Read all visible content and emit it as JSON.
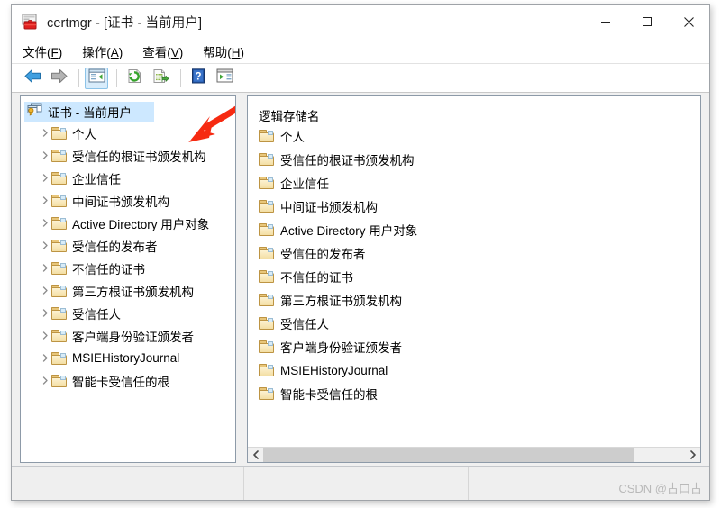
{
  "window": {
    "title": "certmgr - [证书 - 当前用户]",
    "app_icon": "certificate-icon",
    "controls": {
      "minimize": "minimize-icon",
      "maximize": "maximize-icon",
      "close": "close-icon"
    }
  },
  "menubar": {
    "items": [
      {
        "text": "文件(F)",
        "label": "文件",
        "accel": "F"
      },
      {
        "text": "操作(A)",
        "label": "操作",
        "accel": "A"
      },
      {
        "text": "查看(V)",
        "label": "查看",
        "accel": "V"
      },
      {
        "text": "帮助(H)",
        "label": "帮助",
        "accel": "H"
      }
    ]
  },
  "toolbar": {
    "buttons": [
      {
        "name": "back-button",
        "icon": "back-arrow-icon"
      },
      {
        "name": "forward-button",
        "icon": "forward-arrow-icon"
      },
      {
        "name": "show-hide-console-tree-button",
        "icon": "console-tree-icon",
        "active": true
      },
      {
        "name": "refresh-button",
        "icon": "refresh-icon"
      },
      {
        "name": "export-list-button",
        "icon": "export-list-icon"
      },
      {
        "name": "help-button",
        "icon": "help-icon"
      },
      {
        "name": "properties-button",
        "icon": "properties-icon"
      }
    ]
  },
  "tree": {
    "root": {
      "label": "证书 - 当前用户",
      "icon": "certificate-store-icon",
      "selected": true
    },
    "items": [
      {
        "label": "个人",
        "icon": "folder-icon",
        "expandable": true
      },
      {
        "label": "受信任的根证书颁发机构",
        "icon": "folder-icon",
        "expandable": true
      },
      {
        "label": "企业信任",
        "icon": "folder-icon",
        "expandable": true
      },
      {
        "label": "中间证书颁发机构",
        "icon": "folder-icon",
        "expandable": true
      },
      {
        "label": "Active Directory 用户对象",
        "icon": "folder-icon",
        "expandable": true
      },
      {
        "label": "受信任的发布者",
        "icon": "folder-icon",
        "expandable": true
      },
      {
        "label": "不信任的证书",
        "icon": "folder-icon",
        "expandable": true
      },
      {
        "label": "第三方根证书颁发机构",
        "icon": "folder-icon",
        "expandable": true
      },
      {
        "label": "受信任人",
        "icon": "folder-icon",
        "expandable": true
      },
      {
        "label": "客户端身份验证颁发者",
        "icon": "folder-icon",
        "expandable": true
      },
      {
        "label": "MSIEHistoryJournal",
        "icon": "folder-icon",
        "expandable": true
      },
      {
        "label": "智能卡受信任的根",
        "icon": "folder-icon",
        "expandable": true
      }
    ]
  },
  "list": {
    "column_header": "逻辑存储名",
    "rows": [
      {
        "label": "个人",
        "icon": "folder-icon"
      },
      {
        "label": "受信任的根证书颁发机构",
        "icon": "folder-icon"
      },
      {
        "label": "企业信任",
        "icon": "folder-icon"
      },
      {
        "label": "中间证书颁发机构",
        "icon": "folder-icon"
      },
      {
        "label": "Active Directory 用户对象",
        "icon": "folder-icon"
      },
      {
        "label": "受信任的发布者",
        "icon": "folder-icon"
      },
      {
        "label": "不信任的证书",
        "icon": "folder-icon"
      },
      {
        "label": "第三方根证书颁发机构",
        "icon": "folder-icon"
      },
      {
        "label": "受信任人",
        "icon": "folder-icon"
      },
      {
        "label": "客户端身份验证颁发者",
        "icon": "folder-icon"
      },
      {
        "label": "MSIEHistoryJournal",
        "icon": "folder-icon"
      },
      {
        "label": "智能卡受信任的根",
        "icon": "folder-icon"
      }
    ],
    "hscrollbar": {
      "left_arrow": "chevron-left-icon",
      "right_arrow": "chevron-right-icon"
    }
  },
  "statusbar": {
    "segment_1": "",
    "segment_2": "",
    "segment_3": ""
  },
  "watermark": {
    "text": "CSDN @古口古"
  },
  "annotation": {
    "arrow_color": "#f62a11",
    "name": "red-pointer-arrow"
  },
  "colors": {
    "selection": "#cde8ff",
    "folder": "#f3dea4",
    "toolbar_active": "#d8ecfb",
    "panel_border": "#8d9aa8"
  }
}
